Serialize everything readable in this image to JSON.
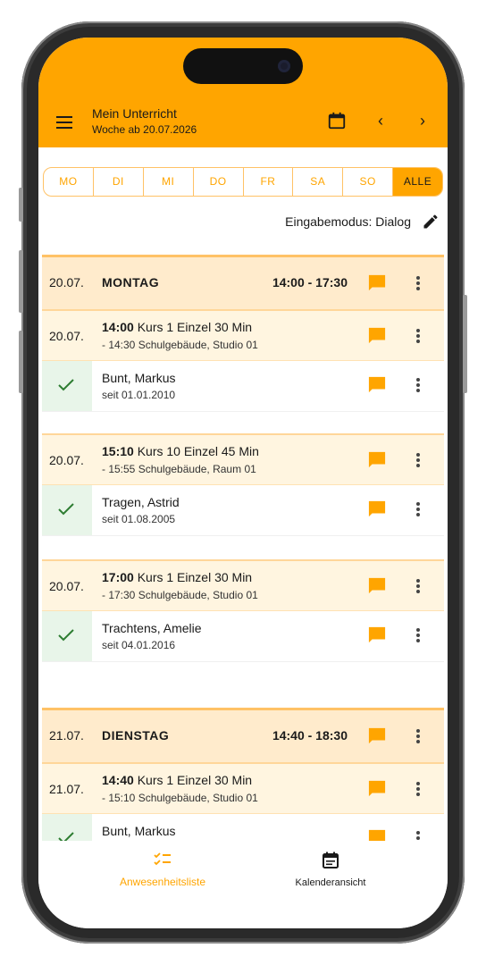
{
  "header": {
    "title": "Mein Unterricht",
    "subtitle": "Woche ab 20.07.2026",
    "menu_icon": "menu-icon",
    "calendar_icon": "calendar-icon",
    "prev": "‹",
    "next": "›"
  },
  "day_tabs": [
    "MO",
    "DI",
    "MI",
    "DO",
    "FR",
    "SA",
    "SO",
    "ALLE"
  ],
  "active_tab": "ALLE",
  "input_mode": "Eingabemodus: Dialog",
  "days": [
    {
      "date": "20.07.",
      "name": "MONTAG",
      "time": "14:00 - 17:30",
      "lessons": [
        {
          "date": "20.07.",
          "start": "14:00",
          "title": "Kurs 1 Einzel 30 Min",
          "detail": "- 14:30 Schulgebäude, Studio 01",
          "student": {
            "name": "Bunt, Markus",
            "since": "seit 01.01.2010"
          }
        },
        {
          "date": "20.07.",
          "start": "15:10",
          "title": "Kurs 10 Einzel 45 Min",
          "detail": "- 15:55 Schulgebäude, Raum 01",
          "student": {
            "name": "Tragen, Astrid",
            "since": "seit 01.08.2005"
          }
        },
        {
          "date": "20.07.",
          "start": "17:00",
          "title": "Kurs 1 Einzel 30 Min",
          "detail": "- 17:30 Schulgebäude, Studio 01",
          "student": {
            "name": "Trachtens, Amelie",
            "since": "seit 04.01.2016"
          }
        }
      ]
    },
    {
      "date": "21.07.",
      "name": "DIENSTAG",
      "time": "14:40 - 18:30",
      "lessons": [
        {
          "date": "21.07.",
          "start": "14:40",
          "title": "Kurs 1 Einzel 30 Min",
          "detail": "- 15:10 Schulgebäude, Studio 01",
          "student": {
            "name": "Bunt, Markus",
            "since": ""
          }
        }
      ]
    }
  ],
  "bottom_nav": {
    "attendance_label": "Anwesenheitsliste",
    "calendar_label": "Kalenderansicht"
  },
  "colors": {
    "accent": "#FFA500",
    "day_row": "#FFEBCC",
    "lesson_row": "#FFF5E0",
    "check_bg": "#E8F5E9",
    "check": "#2E7D32"
  }
}
